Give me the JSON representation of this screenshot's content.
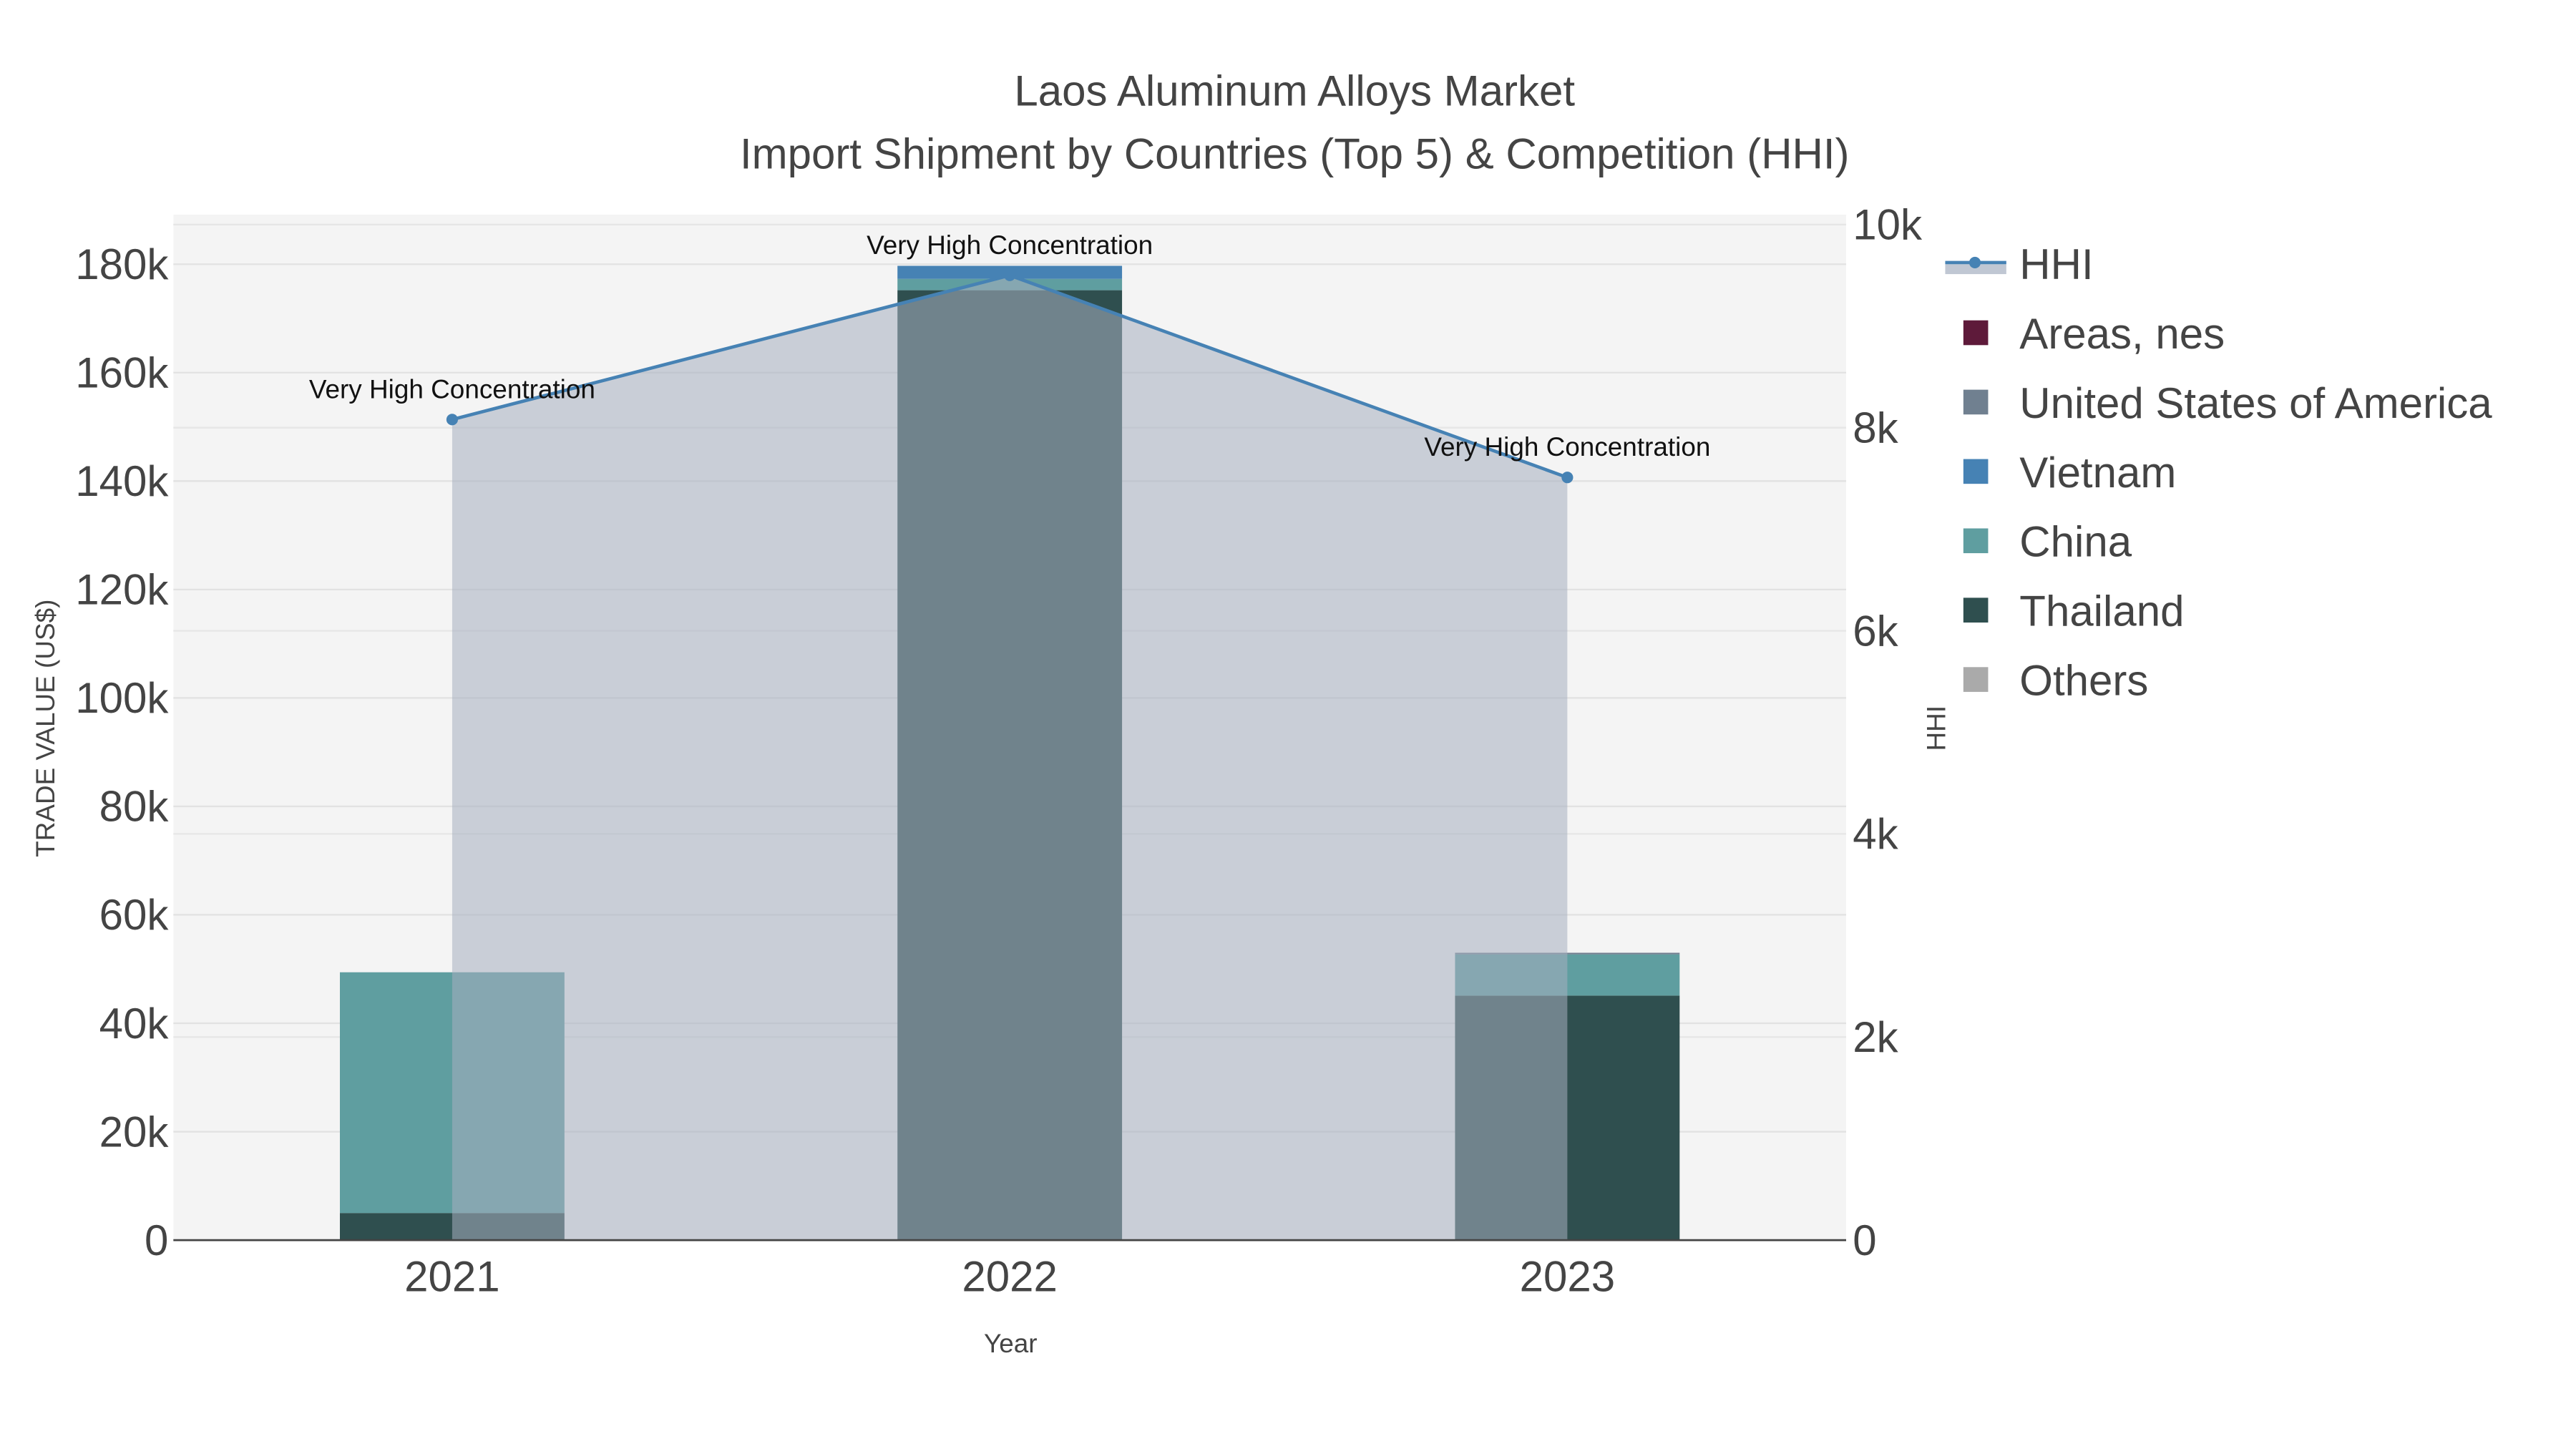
{
  "chart_data": {
    "type": "bar",
    "title": "Laos Aluminum Alloys Market",
    "subtitle": "Import Shipment by Countries (Top 5) & Competition (HHI)",
    "xlabel": "Year",
    "ylabel": "TRADE VALUE (US$)",
    "y2label": "HHI",
    "categories": [
      "2021",
      "2022",
      "2023"
    ],
    "ylim": [
      0,
      188000
    ],
    "y2lim": [
      0,
      10000
    ],
    "yticks": [
      0,
      20000,
      40000,
      60000,
      80000,
      100000,
      120000,
      140000,
      160000,
      180000
    ],
    "ytick_labels": [
      "0",
      "20k",
      "40k",
      "60k",
      "80k",
      "100k",
      "120k",
      "140k",
      "160k",
      "180k"
    ],
    "y2ticks": [
      0,
      2000,
      4000,
      6000,
      8000,
      10000
    ],
    "y2tick_labels": [
      "0",
      "2k",
      "4k",
      "6k",
      "8k",
      "10k"
    ],
    "stacked": true,
    "series": [
      {
        "name": "Thailand",
        "color": "#2f4f4f",
        "values": [
          5000,
          175200,
          45100
        ]
      },
      {
        "name": "China",
        "color": "#5f9ea0",
        "values": [
          44400,
          2100,
          7600
        ]
      },
      {
        "name": "Vietnam",
        "color": "#4682b4",
        "values": [
          0,
          2400,
          0
        ]
      },
      {
        "name": "United States of America",
        "color": "#708090",
        "values": [
          0,
          0,
          300
        ]
      },
      {
        "name": "Areas, nes",
        "color": "#5e1a3a",
        "values": [
          0,
          0,
          0
        ]
      },
      {
        "name": "Others",
        "color": "#aaaaaa",
        "values": [
          0,
          0,
          0
        ]
      }
    ],
    "hhi": {
      "name": "HHI",
      "color": "#4682b4",
      "values": [
        8080,
        9500,
        7510
      ],
      "annotations": [
        "Very High Concentration",
        "Very High Concentration",
        "Very High Concentration"
      ]
    },
    "legend": [
      "HHI",
      "Areas, nes",
      "United States of America",
      "Vietnam",
      "China",
      "Thailand",
      "Others"
    ],
    "legend_position": "right",
    "grid": true
  }
}
